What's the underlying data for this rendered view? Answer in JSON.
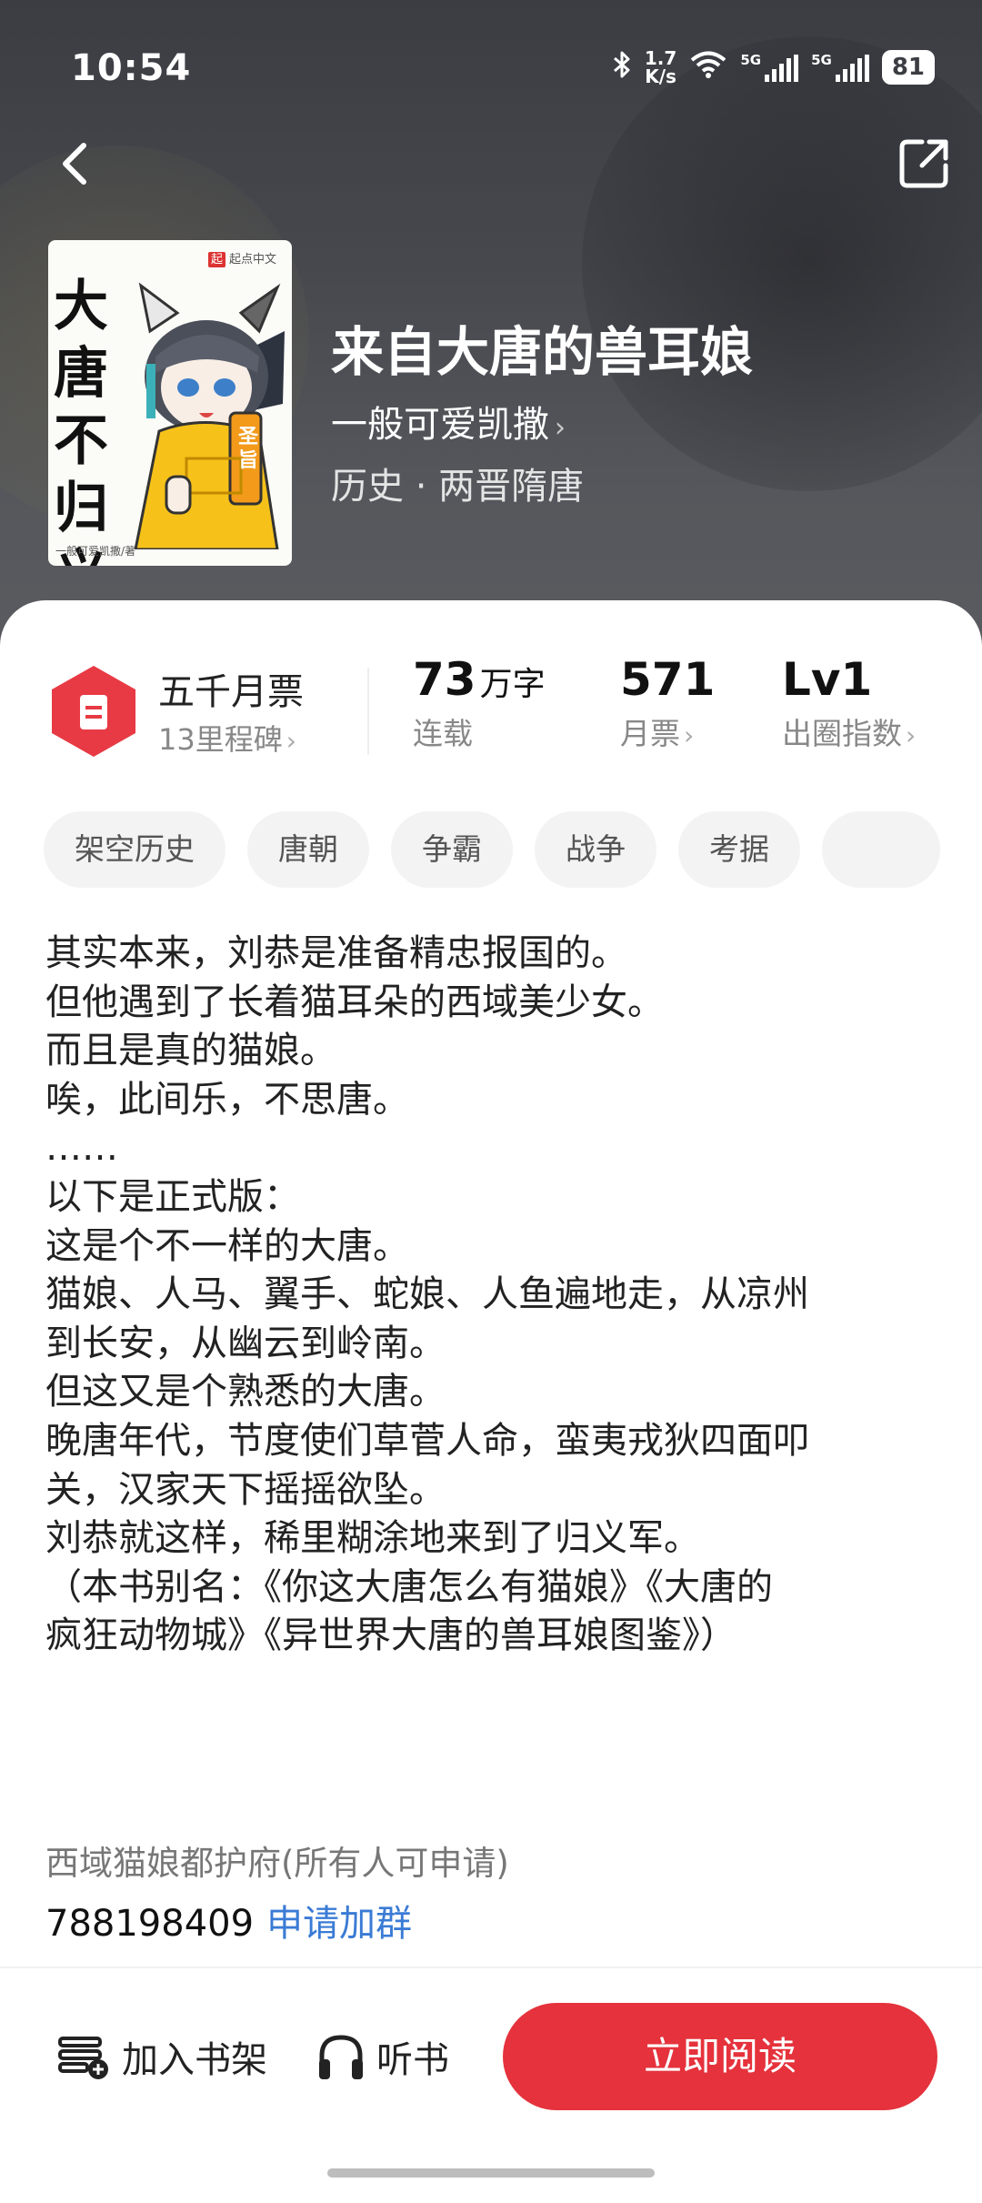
{
  "status_bar": {
    "time": "10:54",
    "net_speed_value": "1.7",
    "net_speed_unit": "K/s",
    "signal1_tag": "5G",
    "signal2_tag": "5G",
    "battery": "81",
    "icons": [
      "bluetooth-icon",
      "wifi-icon",
      "signal-icon",
      "signal-icon",
      "battery-icon"
    ]
  },
  "nav": {
    "back_icon": "chevron-left-icon",
    "share_icon": "share-icon"
  },
  "cover": {
    "title": "大唐不归义",
    "publisher": "起点中文",
    "author_line": "一般可爱凯撒/著",
    "sign_text": "圣旨"
  },
  "book": {
    "title": "来自大唐的兽耳娘",
    "author": "一般可爱凯撒",
    "genre": "历史 · 两晋隋唐"
  },
  "stats": {
    "milestone_title": "五千月票",
    "milestone_sub": "13里程碑",
    "words_value": "73",
    "words_unit": "万字",
    "words_label": "连载",
    "tickets_value": "571",
    "tickets_label": "月票",
    "level_value": "Lv1",
    "level_label": "出圈指数"
  },
  "tags": [
    "架空历史",
    "唐朝",
    "争霸",
    "战争",
    "考据"
  ],
  "description": [
    "其实本来，刘恭是准备精忠报国的。",
    "但他遇到了长着猫耳朵的西域美少女。",
    "而且是真的猫娘。",
    "唉，此间乐，不思唐。",
    "……",
    "以下是正式版：",
    "这是个不一样的大唐。",
    "猫娘、人马、翼手、蛇娘、人鱼遍地走，从凉州",
    "到长安，从幽云到岭南。",
    "但这又是个熟悉的大唐。",
    "晚唐年代，节度使们草菅人命，蛮夷戎狄四面叩",
    "关，汉家天下摇摇欲坠。",
    "刘恭就这样，稀里糊涂地来到了归义军。",
    "（本书别名：《你这大唐怎么有猫娘》《大唐的",
    "疯狂动物城》《异世界大唐的兽耳娘图鉴》）"
  ],
  "group": {
    "name": "西域猫娘都护府(所有人可申请)",
    "id": "788198409",
    "join_label": "申请加群"
  },
  "bottom": {
    "shelf_label": "加入书架",
    "listen_label": "听书",
    "read_label": "立即阅读"
  },
  "colors": {
    "accent": "#e5323c",
    "link": "#3a7bd5",
    "header_bg": "#45474c"
  }
}
